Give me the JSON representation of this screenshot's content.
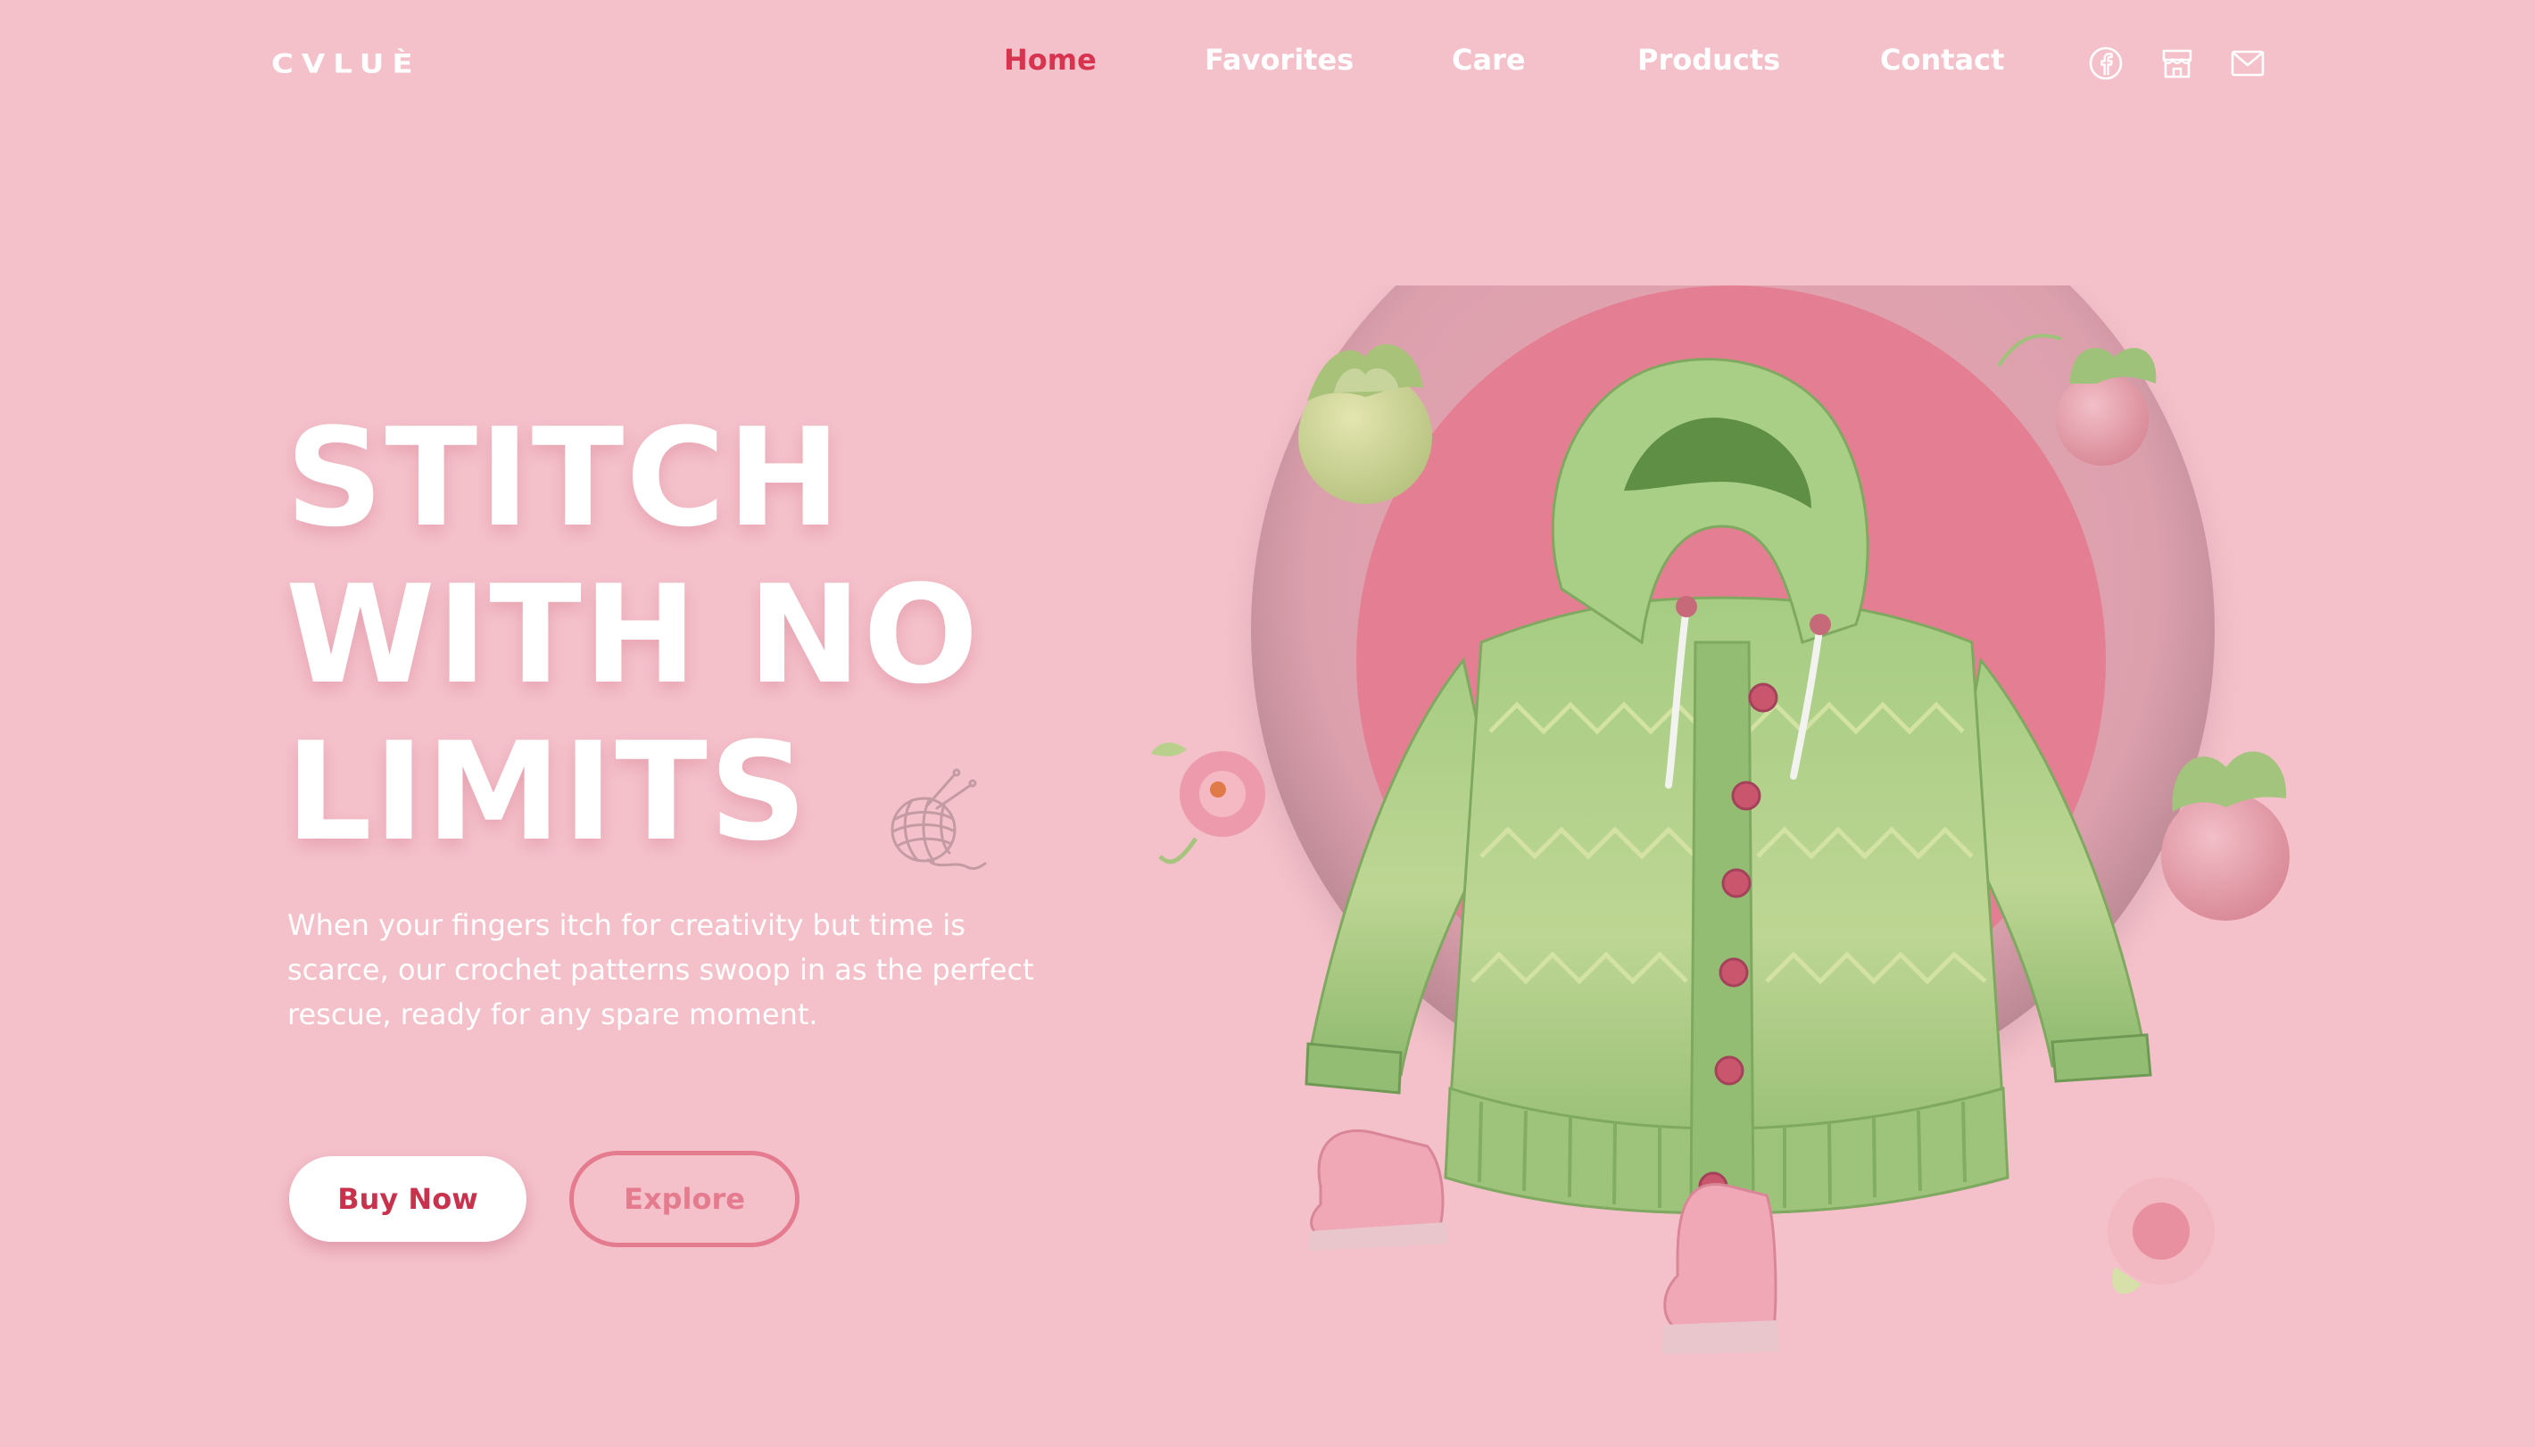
{
  "header": {
    "logo": "CVLUÈ",
    "nav": [
      {
        "label": "Home",
        "active": true
      },
      {
        "label": "Favorites",
        "active": false
      },
      {
        "label": "Care",
        "active": false
      },
      {
        "label": "Products",
        "active": false
      },
      {
        "label": "Contact",
        "active": false
      }
    ],
    "icons": [
      "facebook-icon",
      "store-icon",
      "mail-icon"
    ]
  },
  "hero": {
    "headline": [
      "STITCH",
      "WITH NO",
      "LIMITS"
    ],
    "decor_icon": "yarn-ball-icon",
    "description": "When your fingers itch for creativity but time is scarce, our crochet patterns swoop in as the perfect rescue, ready for any spare moment.",
    "buttons": {
      "buy_label": "Buy Now",
      "explore_label": "Explore"
    }
  },
  "colors": {
    "background": "#f4c1cb",
    "accent": "#d8334f",
    "sweater_green": "#9cc27a",
    "button_outline": "#e47b8f"
  }
}
